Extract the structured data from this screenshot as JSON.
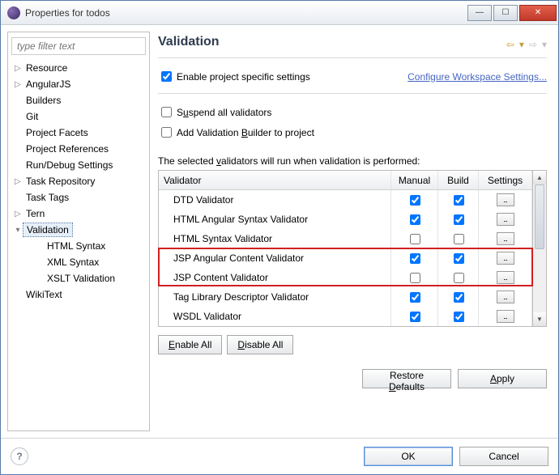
{
  "window": {
    "title": "Properties for todos"
  },
  "sidebar": {
    "filter_placeholder": "type filter text",
    "items": [
      {
        "label": "Resource",
        "twisty": "▷"
      },
      {
        "label": "AngularJS",
        "twisty": "▷"
      },
      {
        "label": "Builders",
        "twisty": ""
      },
      {
        "label": "Git",
        "twisty": ""
      },
      {
        "label": "Project Facets",
        "twisty": ""
      },
      {
        "label": "Project References",
        "twisty": ""
      },
      {
        "label": "Run/Debug Settings",
        "twisty": ""
      },
      {
        "label": "Task Repository",
        "twisty": "▷"
      },
      {
        "label": "Task Tags",
        "twisty": ""
      },
      {
        "label": "Tern",
        "twisty": "▷"
      },
      {
        "label": "Validation",
        "twisty": "▾",
        "selected": true
      },
      {
        "label": "HTML Syntax",
        "child": true
      },
      {
        "label": "XML Syntax",
        "child": true
      },
      {
        "label": "XSLT Validation",
        "child": true
      },
      {
        "label": "WikiText",
        "twisty": ""
      }
    ]
  },
  "main": {
    "heading": "Validation",
    "enable_specific": {
      "label": "Enable project specific settings",
      "checked": true
    },
    "configure_link": "Configure Workspace Settings...",
    "suspend": {
      "label_pre": "S",
      "label_u": "u",
      "label_post": "spend all validators",
      "checked": false
    },
    "add_builder": {
      "label_pre": "Add Validation ",
      "label_u": "B",
      "label_post": "uilder to project",
      "checked": false
    },
    "table_caption_pre": "The selected ",
    "table_caption_u": "v",
    "table_caption_post": "alidators will run when validation is performed:",
    "headers": {
      "validator": "Validator",
      "manual": "Manual",
      "build": "Build",
      "settings": "Settings"
    },
    "rows": [
      {
        "name": "DTD Validator",
        "manual": true,
        "build": true
      },
      {
        "name": "HTML Angular Syntax Validator",
        "manual": true,
        "build": true
      },
      {
        "name": "HTML Syntax Validator",
        "manual": false,
        "build": false
      },
      {
        "name": "JSP Angular Content Validator",
        "manual": true,
        "build": true,
        "hl": true
      },
      {
        "name": "JSP Content Validator",
        "manual": false,
        "build": false,
        "hl": true
      },
      {
        "name": "Tag Library Descriptor Validator",
        "manual": true,
        "build": true
      },
      {
        "name": "WSDL Validator",
        "manual": true,
        "build": true
      }
    ],
    "enable_all_pre": "",
    "enable_all_u": "E",
    "enable_all_post": "nable All",
    "disable_all_pre": "",
    "disable_all_u": "D",
    "disable_all_post": "isable All",
    "restore_pre": "Restore ",
    "restore_u": "D",
    "restore_post": "efaults",
    "apply_u": "A",
    "apply_post": "pply"
  },
  "footer": {
    "ok": "OK",
    "cancel": "Cancel"
  }
}
